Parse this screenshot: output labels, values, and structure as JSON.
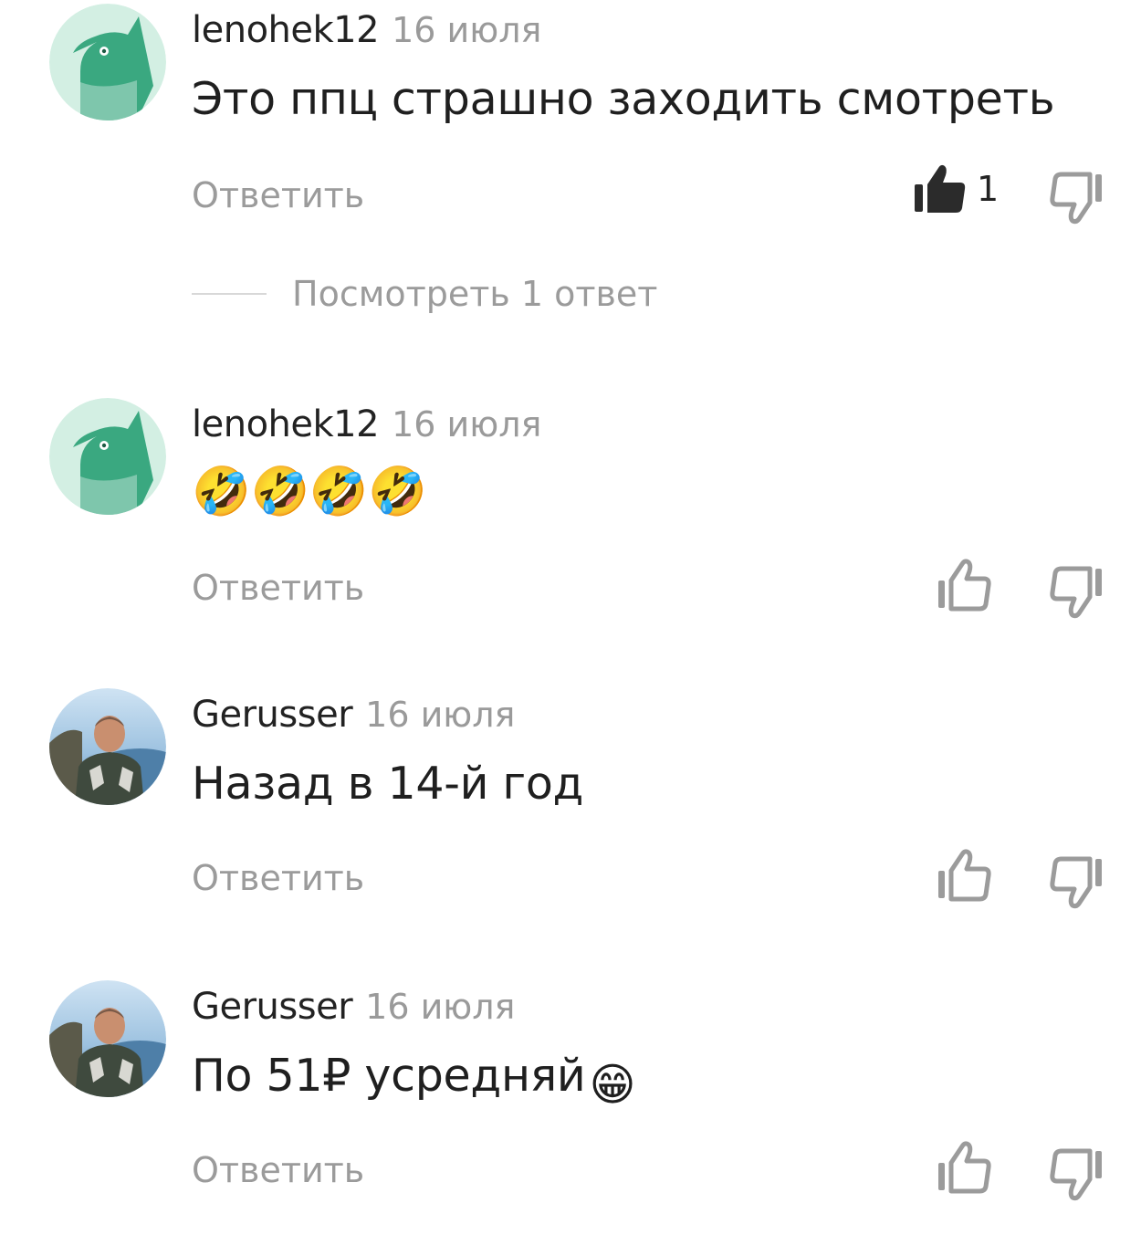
{
  "comments": [
    {
      "author": "lenohek12",
      "date": "16 июля",
      "text": "Это ппц страшно заходить смотреть",
      "reply_label": "Ответить",
      "like_count": "1",
      "liked": true,
      "avatar_icon": "bird-avatar-icon"
    },
    {
      "author": "lenohek12",
      "date": "16 июля",
      "text": "🤣🤣🤣🤣",
      "reply_label": "Ответить",
      "like_count": "",
      "liked": false,
      "avatar_icon": "bird-avatar-icon"
    },
    {
      "author": "Gerusser",
      "date": "16 июля",
      "text": "Назад в 14-й год",
      "reply_label": "Ответить",
      "like_count": "",
      "liked": false,
      "avatar_icon": "user-photo-avatar"
    },
    {
      "author": "Gerusser",
      "date": "16 июля",
      "text": "По 51₽ усредняй",
      "text_emoji": "😁",
      "reply_label": "Ответить",
      "like_count": "",
      "liked": false,
      "avatar_icon": "user-photo-avatar"
    }
  ],
  "view_replies": {
    "label": "Посмотреть 1 ответ"
  },
  "colors": {
    "bird_green": "#3aa880",
    "bird_bg": "#d3efe3",
    "muted_text": "#9b9b9b",
    "icon_dark": "#2b2b2b",
    "icon_grey": "#9b9b9b"
  }
}
